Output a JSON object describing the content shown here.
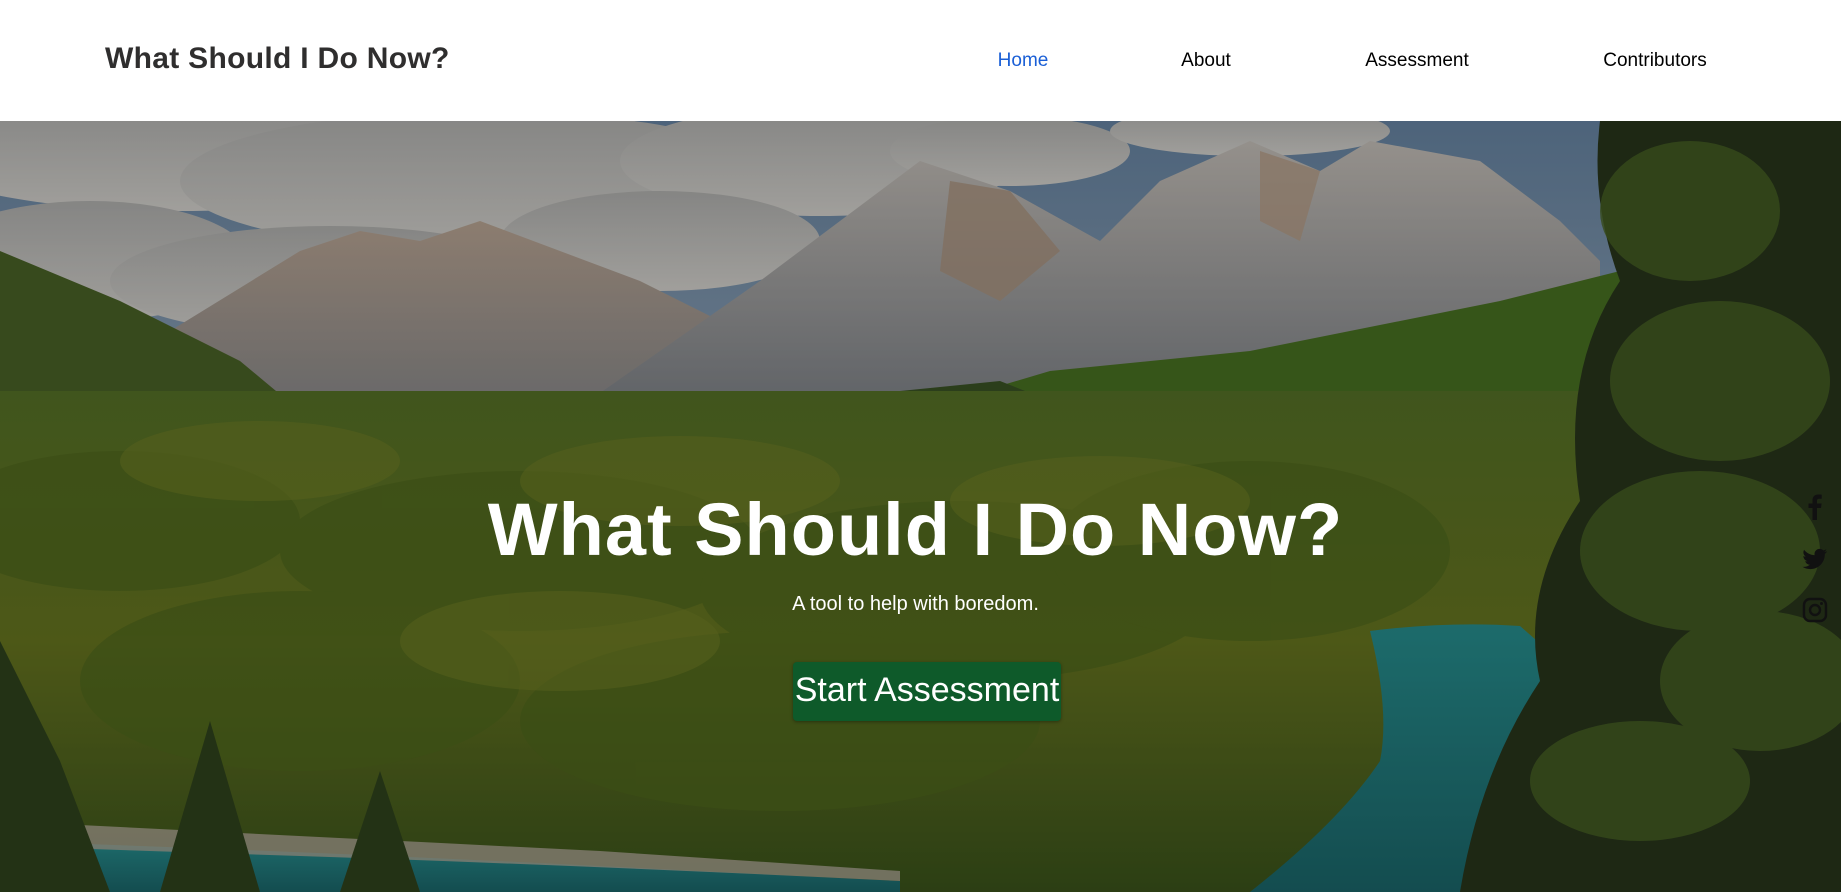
{
  "header": {
    "site_title": "What Should I Do Now?",
    "nav": [
      {
        "label": "Home",
        "active": true
      },
      {
        "label": "About",
        "active": false
      },
      {
        "label": "Assessment",
        "active": false
      },
      {
        "label": "Contributors",
        "active": false
      }
    ]
  },
  "hero": {
    "title": "What Should I Do Now?",
    "subtitle": "A tool to help with boredom.",
    "cta_label": "Start Assessment"
  },
  "social": [
    {
      "icon": "facebook-icon"
    },
    {
      "icon": "twitter-icon"
    },
    {
      "icon": "instagram-icon"
    }
  ],
  "colors": {
    "nav_active": "#1a5fd6",
    "cta_background": "#0e5a2a",
    "title_text": "#2f2e2e",
    "hero_text": "#ffffff"
  }
}
